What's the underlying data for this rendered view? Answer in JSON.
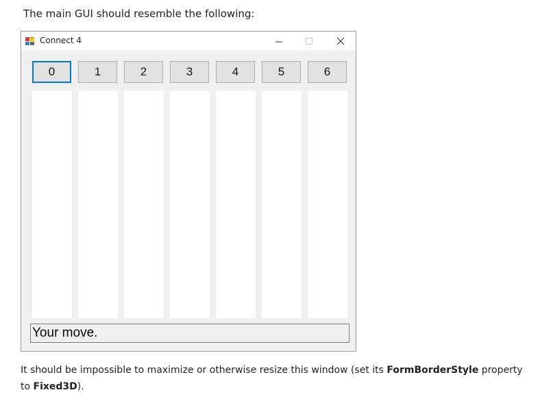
{
  "intro_text": "The main GUI should resemble the following:",
  "window": {
    "title": "Connect 4",
    "controls": {
      "minimize_icon": "minimize-icon",
      "maximize_icon": "maximize-icon",
      "close_icon": "close-icon"
    },
    "column_buttons": [
      "0",
      "1",
      "2",
      "3",
      "4",
      "5",
      "6"
    ],
    "focused_column": "0",
    "status": "Your move."
  },
  "outro": {
    "part1": "It should be impossible to maximize or otherwise resize this window (set its ",
    "prop": "FormBorderStyle",
    "part2": " property to ",
    "value": "Fixed3D",
    "part3": ")."
  }
}
